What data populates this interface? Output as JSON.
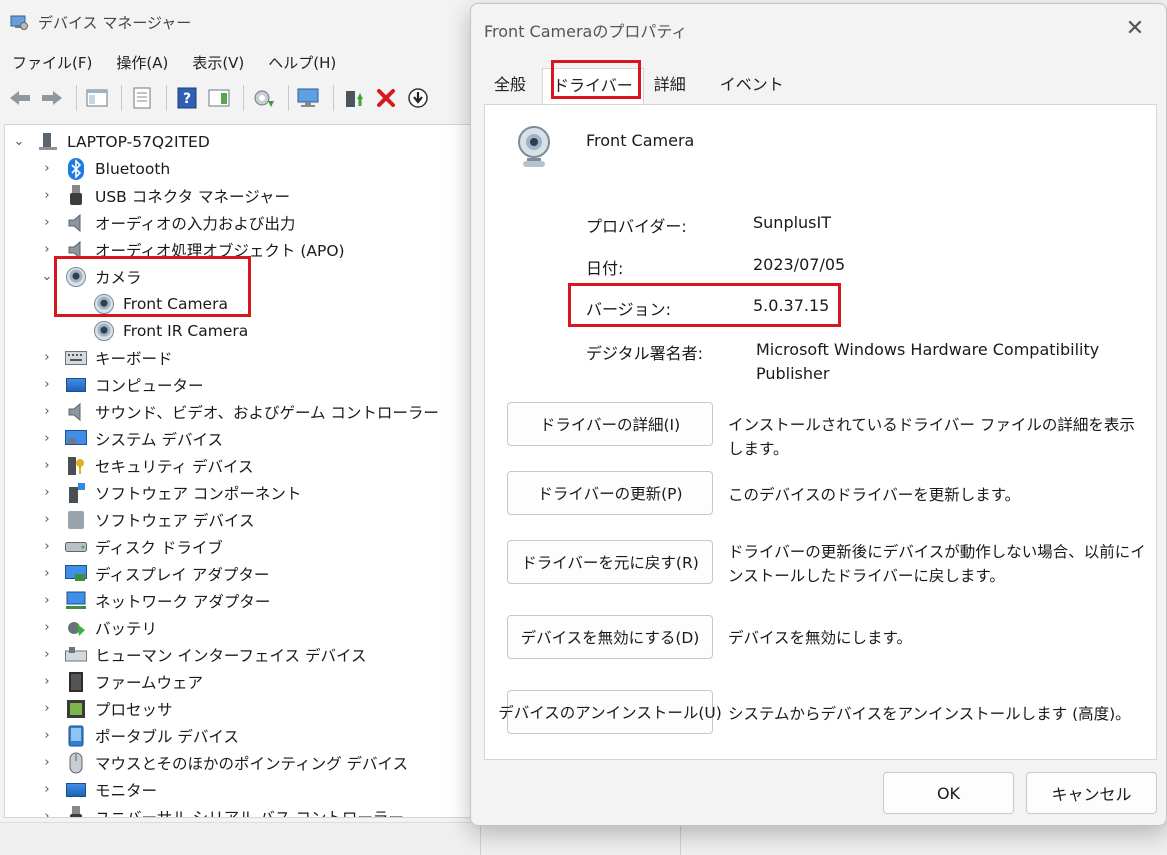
{
  "device_manager": {
    "title": "デバイス マネージャー",
    "menus": [
      "ファイル(F)",
      "操作(A)",
      "表示(V)",
      "ヘルプ(H)"
    ],
    "tree": {
      "root": "LAPTOP-57Q2ITED",
      "categories": [
        {
          "label": "Bluetooth",
          "icon": "bluetooth-icon",
          "expanded": false
        },
        {
          "label": "USB コネクタ マネージャー",
          "icon": "usb-icon",
          "expanded": false
        },
        {
          "label": "オーディオの入力および出力",
          "icon": "speaker-icon",
          "expanded": false
        },
        {
          "label": "オーディオ処理オブジェクト (APO)",
          "icon": "speaker-icon",
          "expanded": false
        },
        {
          "label": "カメラ",
          "icon": "camera-icon",
          "expanded": true,
          "children": [
            "Front Camera",
            "Front IR Camera"
          ]
        },
        {
          "label": "キーボード",
          "icon": "keyboard-icon",
          "expanded": false
        },
        {
          "label": "コンピューター",
          "icon": "computer-icon",
          "expanded": false
        },
        {
          "label": "サウンド、ビデオ、およびゲーム コントローラー",
          "icon": "speaker-icon",
          "expanded": false
        },
        {
          "label": "システム デバイス",
          "icon": "system-device-icon",
          "expanded": false
        },
        {
          "label": "セキュリティ デバイス",
          "icon": "security-key-icon",
          "expanded": false
        },
        {
          "label": "ソフトウェア コンポーネント",
          "icon": "software-component-icon",
          "expanded": false
        },
        {
          "label": "ソフトウェア デバイス",
          "icon": "software-device-icon",
          "expanded": false
        },
        {
          "label": "ディスク ドライブ",
          "icon": "disk-drive-icon",
          "expanded": false
        },
        {
          "label": "ディスプレイ アダプター",
          "icon": "display-adapter-icon",
          "expanded": false
        },
        {
          "label": "ネットワーク アダプター",
          "icon": "network-adapter-icon",
          "expanded": false
        },
        {
          "label": "バッテリ",
          "icon": "battery-icon",
          "expanded": false
        },
        {
          "label": "ヒューマン インターフェイス デバイス",
          "icon": "hid-icon",
          "expanded": false
        },
        {
          "label": "ファームウェア",
          "icon": "firmware-icon",
          "expanded": false
        },
        {
          "label": "プロセッサ",
          "icon": "processor-icon",
          "expanded": false
        },
        {
          "label": "ポータブル デバイス",
          "icon": "portable-device-icon",
          "expanded": false
        },
        {
          "label": "マウスとそのほかのポインティング デバイス",
          "icon": "mouse-icon",
          "expanded": false
        },
        {
          "label": "モニター",
          "icon": "monitor-icon",
          "expanded": false
        },
        {
          "label": "ユニバーサル シリアル バス コントローラー",
          "icon": "usb-icon",
          "expanded": false
        }
      ]
    }
  },
  "dialog": {
    "title": "Front Cameraのプロパティ",
    "tabs": [
      "全般",
      "ドライバー",
      "詳細",
      "イベント"
    ],
    "active_tab": "ドライバー",
    "device_name": "Front Camera",
    "fields": {
      "provider_label": "プロバイダー:",
      "provider_value": "SunplusIT",
      "date_label": "日付:",
      "date_value": "2023/07/05",
      "version_label": "バージョン:",
      "version_value": "5.0.37.15",
      "signer_label": "デジタル署名者:",
      "signer_value_line1": "Microsoft Windows Hardware Compatibility",
      "signer_value_line2": "Publisher"
    },
    "actions": [
      {
        "label": "ドライバーの詳細(I)",
        "desc": "インストールされているドライバー ファイルの詳細を表示します。"
      },
      {
        "label": "ドライバーの更新(P)",
        "desc": "このデバイスのドライバーを更新します。"
      },
      {
        "label": "ドライバーを元に戻す(R)",
        "desc": "ドライバーの更新後にデバイスが動作しない場合、以前にインストールしたドライバーに戻します。"
      },
      {
        "label": "デバイスを無効にする(D)",
        "desc": "デバイスを無効にします。"
      },
      {
        "label": "デバイスのアンインストール(U)",
        "desc": "システムからデバイスをアンインストールします (高度)。"
      }
    ],
    "ok_label": "OK",
    "cancel_label": "キャンセル",
    "close_glyph": "✕"
  },
  "colors": {
    "highlight": "#d7171f",
    "window_bg": "#f3f3f3",
    "panel_bg": "#ffffff"
  }
}
